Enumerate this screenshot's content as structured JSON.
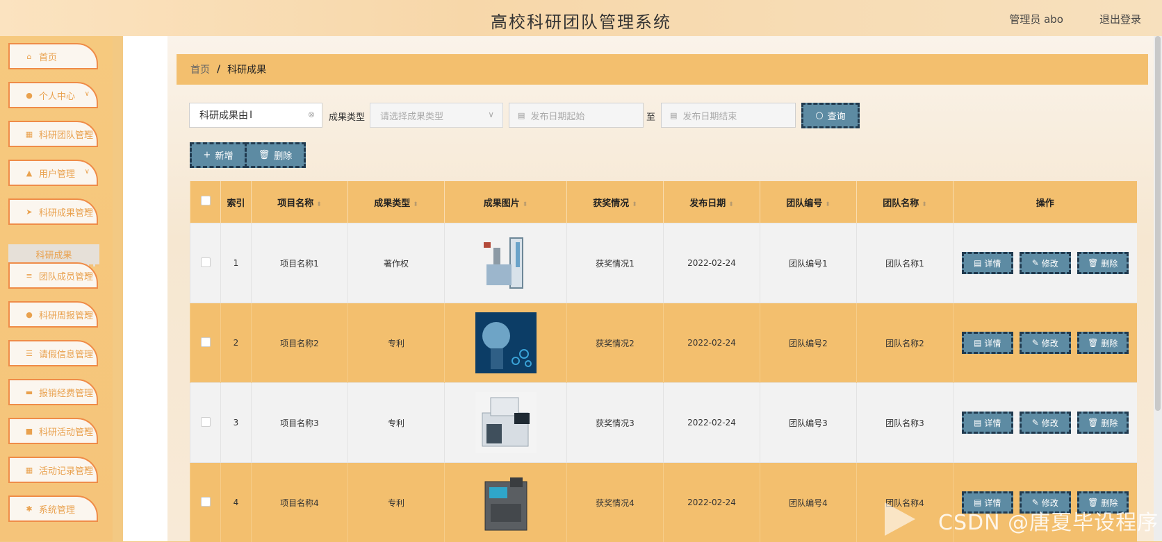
{
  "header": {
    "title": "高校科研团队管理系统",
    "user": "管理员 abo",
    "logout": "退出登录"
  },
  "sidebar": {
    "items": [
      {
        "label": "首页",
        "icon": "home-icon"
      },
      {
        "label": "个人中心",
        "icon": "user-icon"
      },
      {
        "label": "科研团队管理",
        "icon": "grid-icon"
      },
      {
        "label": "用户管理",
        "icon": "thumb-icon"
      },
      {
        "label": "科研成果管理",
        "icon": "send-icon"
      },
      {
        "label": "团队成员管理",
        "icon": "list-icon"
      },
      {
        "label": "科研周报管理",
        "icon": "user-icon"
      },
      {
        "label": "请假信息管理",
        "icon": "sliders-icon"
      },
      {
        "label": "报销经费管理",
        "icon": "ticket-icon"
      },
      {
        "label": "科研活动管理",
        "icon": "chat-icon"
      },
      {
        "label": "活动记录管理",
        "icon": "grid-icon"
      },
      {
        "label": "系统管理",
        "icon": "gear-icon"
      }
    ],
    "sub_item": "科研成果"
  },
  "breadcrumb": {
    "home": "首页",
    "current": "科研成果"
  },
  "search": {
    "name_value": "科研成果由",
    "type_label": "成果类型",
    "type_placeholder": "请选择成果类型",
    "date_start_placeholder": "发布日期起始",
    "to": "至",
    "date_end_placeholder": "发布日期结束",
    "query": "查询"
  },
  "toolbar": {
    "add": "新增",
    "delete": "删除"
  },
  "table": {
    "headers": [
      "索引",
      "项目名称",
      "成果类型",
      "成果图片",
      "获奖情况",
      "发布日期",
      "团队编号",
      "团队名称",
      "操作"
    ],
    "rows": [
      {
        "index": "1",
        "name": "项目名称1",
        "type": "著作权",
        "award": "获奖情况1",
        "date": "2022-02-24",
        "team_no": "团队编号1",
        "team_name": "团队名称1"
      },
      {
        "index": "2",
        "name": "项目名称2",
        "type": "专利",
        "award": "获奖情况2",
        "date": "2022-02-24",
        "team_no": "团队编号2",
        "team_name": "团队名称2"
      },
      {
        "index": "3",
        "name": "项目名称3",
        "type": "专利",
        "award": "获奖情况3",
        "date": "2022-02-24",
        "team_no": "团队编号3",
        "team_name": "团队名称3"
      },
      {
        "index": "4",
        "name": "项目名称4",
        "type": "专利",
        "award": "获奖情况4",
        "date": "2022-02-24",
        "team_no": "团队编号4",
        "team_name": "团队名称4"
      }
    ],
    "ops": {
      "detail": "详情",
      "edit": "修改",
      "delete": "删除"
    }
  },
  "watermark": "CSDN @唐夏毕设程序",
  "colors": {
    "accent": "#f3bf6e",
    "button": "#5d8ba3",
    "menu_border": "#ef8c48"
  }
}
